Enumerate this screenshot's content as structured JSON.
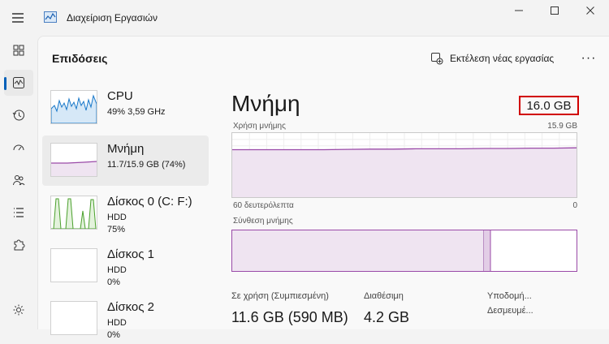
{
  "window": {
    "title": "Διαχείριση Εργασιών"
  },
  "header": {
    "page_title": "Επιδόσεις",
    "run_task_label": "Εκτέλεση νέας εργασίας",
    "more_label": "···"
  },
  "perf_items": [
    {
      "name": "CPU",
      "sub1": "49%  3,59 GHz"
    },
    {
      "name": "Μνήμη",
      "sub1": "11.7/15.9 GB (74%)"
    },
    {
      "name": "Δίσκος 0 (C: F:)",
      "sub1": "HDD",
      "sub2": "75%"
    },
    {
      "name": "Δίσκος 1",
      "sub1": "HDD",
      "sub2": "0%"
    },
    {
      "name": "Δίσκος 2",
      "sub1": "HDD",
      "sub2": "0%"
    }
  ],
  "detail": {
    "title": "Μνήμη",
    "total": "16.0 GB",
    "usage_label": "Χρήση μνήμης",
    "usage_max": "15.9 GB",
    "time_left": "60 δευτερόλεπτα",
    "time_right": "0",
    "composition_label": "Σύνθεση μνήμης",
    "in_use_label": "Σε χρήση (Συμπιεσμένη)",
    "in_use_value": "11.6 GB (590 MB)",
    "available_label": "Διαθέσιμη",
    "available_value": "4.2 GB",
    "structure_label": "Υποδομή...",
    "reserved_label": "Δεσμευμέ..."
  },
  "chart_data": {
    "type": "area",
    "usage_percent": [
      0.74,
      0.74,
      0.74,
      0.74,
      0.74,
      0.745,
      0.75,
      0.75,
      0.755,
      0.755,
      0.755,
      0.76,
      0.76,
      0.765,
      0.765,
      0.77
    ],
    "composition": {
      "in_use_fraction": 0.73,
      "modified_fraction": 0.02
    }
  },
  "colors": {
    "accent": "#9a4aa8",
    "fill": "#efe4f1",
    "highlight": "#d10000",
    "cpu": "#1777c9",
    "disk": "#4aa02c"
  }
}
